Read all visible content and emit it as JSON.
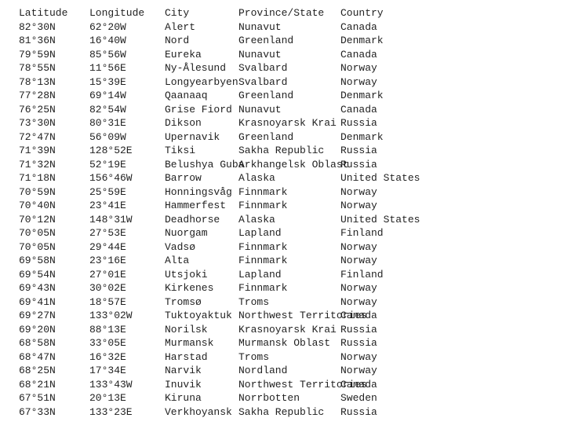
{
  "headers": {
    "lat": "Latitude",
    "lon": "Longitude",
    "city": "City",
    "prov": "Province/State",
    "ctry": "Country"
  },
  "rows": [
    {
      "lat": "82°30N",
      "lon": "62°20W",
      "city": "Alert",
      "prov": "Nunavut",
      "ctry": "Canada"
    },
    {
      "lat": "81°36N",
      "lon": "16°40W",
      "city": "Nord",
      "prov": "Greenland",
      "ctry": "Denmark"
    },
    {
      "lat": "79°59N",
      "lon": "85°56W",
      "city": "Eureka",
      "prov": "Nunavut",
      "ctry": "Canada"
    },
    {
      "lat": "78°55N",
      "lon": "11°56E",
      "city": "Ny-Ålesund",
      "prov": "Svalbard",
      "ctry": "Norway"
    },
    {
      "lat": "78°13N",
      "lon": "15°39E",
      "city": "Longyearbyen",
      "prov": "Svalbard",
      "ctry": "Norway"
    },
    {
      "lat": "77°28N",
      "lon": "69°14W",
      "city": "Qaanaaq",
      "prov": "Greenland",
      "ctry": "Denmark"
    },
    {
      "lat": "76°25N",
      "lon": "82°54W",
      "city": "Grise Fiord",
      "prov": "Nunavut",
      "ctry": "Canada"
    },
    {
      "lat": "73°30N",
      "lon": "80°31E",
      "city": "Dikson",
      "prov": "Krasnoyarsk Krai",
      "ctry": "Russia"
    },
    {
      "lat": "72°47N",
      "lon": "56°09W",
      "city": "Upernavik",
      "prov": "Greenland",
      "ctry": "Denmark"
    },
    {
      "lat": "71°39N",
      "lon": "128°52E",
      "city": "Tiksi",
      "prov": "Sakha Republic",
      "ctry": "Russia"
    },
    {
      "lat": "71°32N",
      "lon": "52°19E",
      "city": "Belushya Guba",
      "prov": "Arkhangelsk Oblast",
      "ctry": "Russia"
    },
    {
      "lat": "71°18N",
      "lon": "156°46W",
      "city": "Barrow",
      "prov": "Alaska",
      "ctry": "United States"
    },
    {
      "lat": "70°59N",
      "lon": "25°59E",
      "city": "Honningsvåg",
      "prov": "Finnmark",
      "ctry": "Norway"
    },
    {
      "lat": "70°40N",
      "lon": "23°41E",
      "city": "Hammerfest",
      "prov": "Finnmark",
      "ctry": "Norway"
    },
    {
      "lat": "70°12N",
      "lon": "148°31W",
      "city": "Deadhorse",
      "prov": "Alaska",
      "ctry": "United States"
    },
    {
      "lat": "70°05N",
      "lon": "27°53E",
      "city": "Nuorgam",
      "prov": "Lapland",
      "ctry": "Finland"
    },
    {
      "lat": "70°05N",
      "lon": "29°44E",
      "city": "Vadsø",
      "prov": "Finnmark",
      "ctry": "Norway"
    },
    {
      "lat": "69°58N",
      "lon": "23°16E",
      "city": "Alta",
      "prov": "Finnmark",
      "ctry": "Norway"
    },
    {
      "lat": "69°54N",
      "lon": "27°01E",
      "city": "Utsjoki",
      "prov": "Lapland",
      "ctry": "Finland"
    },
    {
      "lat": "69°43N",
      "lon": "30°02E",
      "city": "Kirkenes",
      "prov": "Finnmark",
      "ctry": "Norway"
    },
    {
      "lat": "69°41N",
      "lon": "18°57E",
      "city": "Tromsø",
      "prov": "Troms",
      "ctry": "Norway"
    },
    {
      "lat": "69°27N",
      "lon": "133°02W",
      "city": "Tuktoyaktuk",
      "prov": "Northwest Territories",
      "ctry": "Canada"
    },
    {
      "lat": "69°20N",
      "lon": "88°13E",
      "city": "Norilsk",
      "prov": "Krasnoyarsk Krai",
      "ctry": "Russia"
    },
    {
      "lat": "68°58N",
      "lon": "33°05E",
      "city": "Murmansk",
      "prov": "Murmansk Oblast",
      "ctry": "Russia"
    },
    {
      "lat": "68°47N",
      "lon": "16°32E",
      "city": "Harstad",
      "prov": "Troms",
      "ctry": "Norway"
    },
    {
      "lat": "68°25N",
      "lon": "17°34E",
      "city": "Narvik",
      "prov": "Nordland",
      "ctry": "Norway"
    },
    {
      "lat": "68°21N",
      "lon": "133°43W",
      "city": "Inuvik",
      "prov": "Northwest Territories",
      "ctry": "Canada"
    },
    {
      "lat": "67°51N",
      "lon": "20°13E",
      "city": "Kiruna",
      "prov": "Norrbotten",
      "ctry": "Sweden"
    },
    {
      "lat": "67°33N",
      "lon": "133°23E",
      "city": "Verkhoyansk",
      "prov": "Sakha Republic",
      "ctry": "Russia"
    }
  ]
}
